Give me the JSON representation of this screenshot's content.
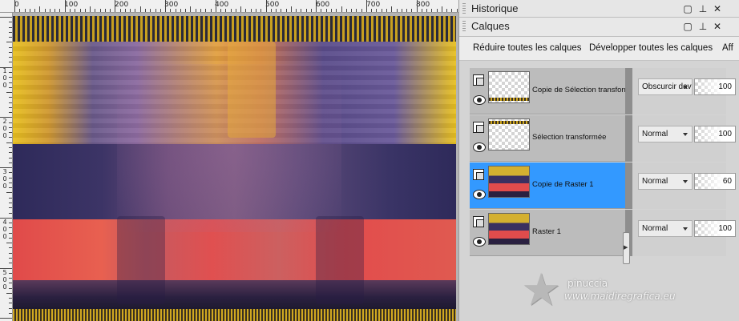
{
  "ruler_top": {
    "labels": [
      "0",
      "100",
      "200",
      "300",
      "400",
      "500",
      "600",
      "700",
      "800"
    ]
  },
  "ruler_left": {
    "labels": [
      "1\n0\n0",
      "2\n0\n0",
      "3\n0\n0",
      "4\n0\n0",
      "5\n0\n0"
    ]
  },
  "history_panel": {
    "title": "Historique",
    "controls": {
      "maximize": "▢",
      "pin": "⊥",
      "close": "✕"
    }
  },
  "layers_panel": {
    "title": "Calques",
    "controls": {
      "maximize": "▢",
      "pin": "⊥",
      "close": "✕"
    },
    "toolbar": {
      "collapse_all": "Réduire toutes les calques",
      "expand_all": "Développer toutes les calques",
      "more": "Aff"
    },
    "layers": [
      {
        "name": "Copie de Sélection transformée",
        "blend_mode": "Obscurcir davantage",
        "opacity": "100",
        "thumbnail": "checker-stripe-bottom",
        "selected": false
      },
      {
        "name": "Sélection transformée",
        "blend_mode": "Normal",
        "opacity": "100",
        "thumbnail": "checker-stripe-top",
        "selected": false
      },
      {
        "name": "Copie de Raster 1",
        "blend_mode": "Normal",
        "opacity": "60",
        "thumbnail": "image",
        "selected": true
      },
      {
        "name": "Raster 1",
        "blend_mode": "Normal",
        "opacity": "100",
        "thumbnail": "image",
        "selected": false
      }
    ]
  },
  "watermark": {
    "line1": "pinuccia",
    "line2": "www.maidiregrafica.eu"
  },
  "colors": {
    "selection": "#3399ff",
    "panel_bg": "#d4d4d4",
    "art_yellow": "#e8c020",
    "art_navy": "#2e2a5a",
    "art_red": "#e04a4a"
  }
}
